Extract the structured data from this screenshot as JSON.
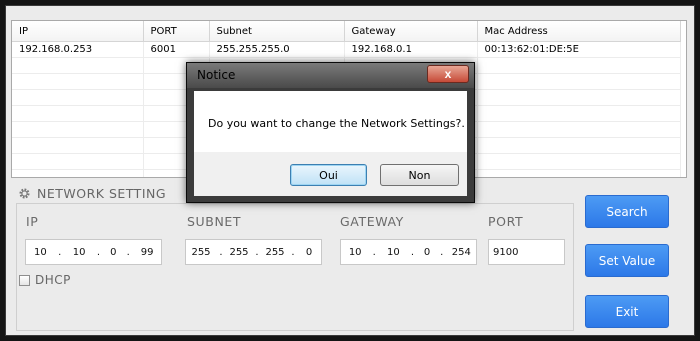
{
  "table": {
    "columns": [
      "IP",
      "PORT",
      "Subnet",
      "Gateway",
      "Mac Address"
    ],
    "rows": [
      [
        "192.168.0.253",
        "6001",
        "255.255.255.0",
        "192.168.0.1",
        "00:13:62:01:DE:5E"
      ]
    ]
  },
  "network_setting": {
    "title": "NETWORK SETTING",
    "ip_label": "IP",
    "ip": [
      "10",
      "10",
      "0",
      "99"
    ],
    "subnet_label": "SUBNET",
    "subnet": [
      "255",
      "255",
      "255",
      "0"
    ],
    "gateway_label": "GATEWAY",
    "gateway": [
      "10",
      "10",
      "0",
      "254"
    ],
    "port_label": "PORT",
    "port": "9100",
    "dhcp_label": "DHCP",
    "dhcp_checked": false
  },
  "buttons": {
    "search": "Search",
    "set_value": "Set Value",
    "exit": "Exit"
  },
  "dialog": {
    "title": "Notice",
    "close": "x",
    "message": "Do you want to change the Network Settings?.",
    "ok": "Oui",
    "cancel": "Non"
  },
  "colors": {
    "accent_button": "#2c78e8",
    "close_button": "#c64a37"
  }
}
